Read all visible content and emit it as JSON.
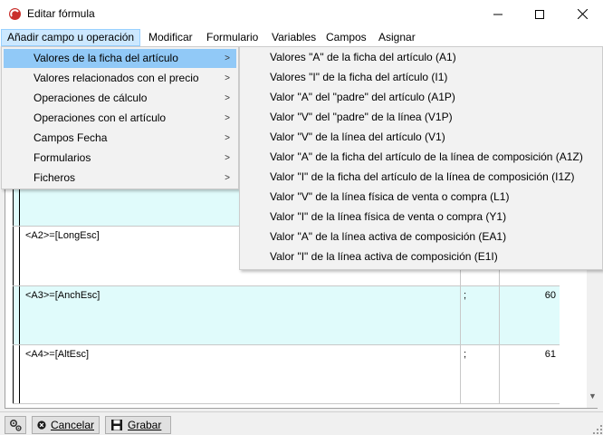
{
  "window": {
    "title": "Editar fórmula"
  },
  "menubar": {
    "items": [
      {
        "label": "Añadir campo u operación"
      },
      {
        "label": "Modificar"
      },
      {
        "label": "Formulario"
      },
      {
        "label": "Variables"
      },
      {
        "label": "Campos"
      },
      {
        "label": "Asignar"
      }
    ]
  },
  "dropdown": {
    "items": [
      {
        "label": "Valores de la ficha del artículo"
      },
      {
        "label": "Valores relacionados con el precio"
      },
      {
        "label": "Operaciones de cálculo"
      },
      {
        "label": "Operaciones con el artículo"
      },
      {
        "label": "Campos Fecha"
      },
      {
        "label": "Formularios"
      },
      {
        "label": "Ficheros"
      }
    ]
  },
  "submenu": {
    "items": [
      {
        "label": "Valores \"A\" de la ficha del artículo (A1)"
      },
      {
        "label": "Valores \"I\" de la ficha del artículo (I1)"
      },
      {
        "label": "Valor \"A\" del \"padre\" del artículo (A1P)"
      },
      {
        "label": "Valor \"V\" del \"padre\" de la línea (V1P)"
      },
      {
        "label": "Valor \"V\" de la línea del artículo (V1)"
      },
      {
        "label": "Valor \"A\" de la ficha del artículo de la línea de composición (A1Z)"
      },
      {
        "label": "Valor \"I\" de la ficha del artículo de la línea de composición (I1Z)"
      },
      {
        "label": "Valor \"V\" de la línea física de venta o compra (L1)"
      },
      {
        "label": "Valor \"I\" de la línea física de venta o compra (Y1)"
      },
      {
        "label": "Valor \"A\" de la línea activa de composición (EA1)"
      },
      {
        "label": "Valor \"I\" de la línea activa de composición (E1I)"
      }
    ]
  },
  "grid": {
    "rows": [
      {
        "formula": "<A2>=[LongEsc]",
        "sep": "",
        "value": ""
      },
      {
        "formula": "<A3>=[AnchEsc]",
        "sep": ";",
        "value": "60"
      },
      {
        "formula": "<A4>=[AltEsc]",
        "sep": ";",
        "value": "61"
      }
    ]
  },
  "toolbar": {
    "cancel_label": "Cancelar",
    "save_label": "Grabar"
  },
  "colors": {
    "menu_highlight": "#91c9f7",
    "row_tint": "#e0fbfb"
  }
}
